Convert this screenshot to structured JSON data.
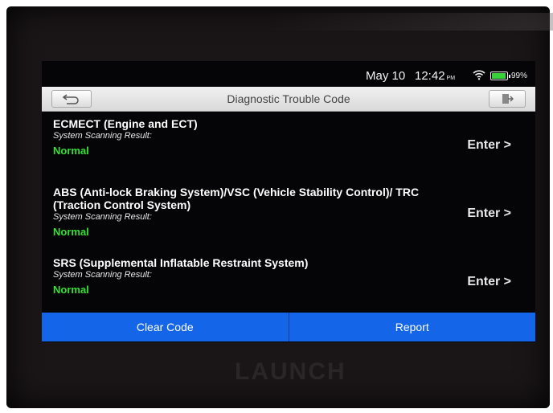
{
  "status": {
    "date": "May 10",
    "time": "12:42",
    "ampm": "PM",
    "battery": "99%",
    "icons": [
      "wifi-icon",
      "battery-icon"
    ]
  },
  "header": {
    "title": "Diagnostic Trouble Code",
    "back_icon": "back-arrow-icon",
    "exit_icon": "exit-icon"
  },
  "systems": [
    {
      "name": "ECMECT (Engine and ECT)",
      "result_label": "System Scanning Result:",
      "status": "Normal",
      "enter": "Enter >"
    },
    {
      "name": "ABS (Anti-lock Braking System)/VSC (Vehicle Stability Control)/ TRC (Traction Control System)",
      "result_label": "System Scanning Result:",
      "status": "Normal",
      "enter": "Enter >"
    },
    {
      "name": "SRS (Supplemental Inflatable Restraint System)",
      "result_label": "System Scanning Result:",
      "status": "Normal",
      "enter": "Enter >"
    }
  ],
  "footer": {
    "clear_code": "Clear Code",
    "report": "Report"
  },
  "device": {
    "brand": "LAUNCH"
  },
  "colors": {
    "accent": "#1565e8",
    "normal": "#33e033",
    "background": "#050507"
  }
}
